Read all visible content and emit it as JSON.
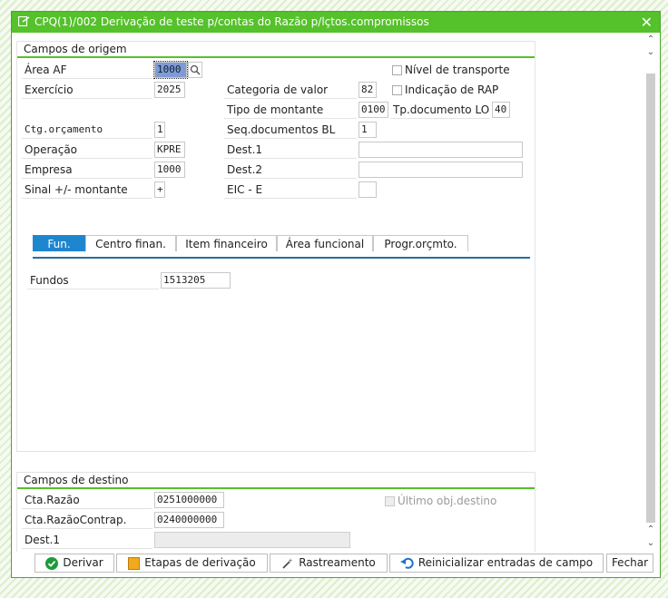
{
  "window": {
    "title": "CPQ(1)/002 Derivação de teste p/contas do Razão p/lçtos.compromissos",
    "close_symbol": "✕"
  },
  "origin": {
    "title": "Campos de origem",
    "area_af": {
      "label": "Área AF",
      "value": "1000"
    },
    "exercicio": {
      "label": "Exercício",
      "value": "2025"
    },
    "ctg_orcamento": {
      "label": "Ctg.orçamento",
      "value": "1"
    },
    "operacao": {
      "label": "Operação",
      "value": "KPRE"
    },
    "empresa": {
      "label": "Empresa",
      "value": "1000"
    },
    "sinal": {
      "label": "Sinal +/- montante",
      "value": "+"
    },
    "categoria_valor": {
      "label": "Categoria de valor",
      "value": "82"
    },
    "tipo_montante": {
      "label": "Tipo de montante",
      "value": "0100"
    },
    "seq_documentos": {
      "label": "Seq.documentos BL",
      "value": "1"
    },
    "dest1": {
      "label": "Dest.1",
      "value": ""
    },
    "dest2": {
      "label": "Dest.2",
      "value": ""
    },
    "eic": {
      "label": "EIC - E",
      "value": ""
    },
    "nivel_transporte": {
      "label": "Nível de transporte",
      "checked": false
    },
    "indicacao_rap": {
      "label": "Indicação de RAP",
      "checked": false
    },
    "tp_documento_lo": {
      "label": "Tp.documento LO",
      "value": "40"
    }
  },
  "tabs": [
    {
      "label": "Fun.",
      "active": true
    },
    {
      "label": "Centro finan.",
      "active": false
    },
    {
      "label": "Item financeiro",
      "active": false
    },
    {
      "label": "Área funcional",
      "active": false
    },
    {
      "label": "Progr.orçmto.",
      "active": false
    }
  ],
  "fundos": {
    "label": "Fundos",
    "value": "1513205"
  },
  "destination": {
    "title": "Campos de destino",
    "cta_razao": {
      "label": "Cta.Razão",
      "value": "0251000000"
    },
    "cta_razao_contrap": {
      "label": "Cta.RazãoContrap.",
      "value": "0240000000"
    },
    "dest1": {
      "label": "Dest.1",
      "value": ""
    },
    "ultimo_obj": {
      "label": "Último obj.destino",
      "checked": false
    }
  },
  "buttons": {
    "derivar": "Derivar",
    "etapas": "Etapas de derivação",
    "rastreamento": "Rastreamento",
    "reinicializar": "Reinicializar entradas de campo",
    "fechar": "Fechar"
  },
  "colors": {
    "accent": "#55c12b",
    "tab_active": "#1e86cf"
  }
}
